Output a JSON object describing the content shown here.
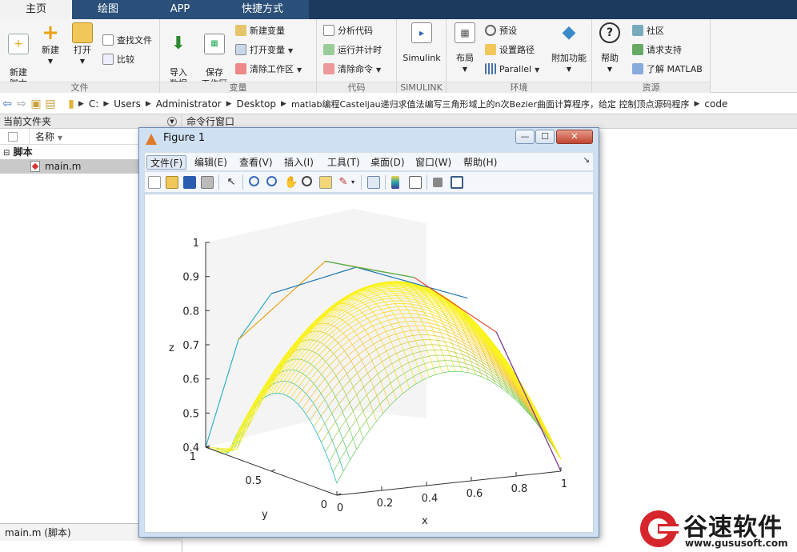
{
  "tabs": [
    "主页",
    "绘图",
    "APP",
    "快捷方式"
  ],
  "ribbon": {
    "file_group": {
      "label": "文件",
      "new_script": "新建\n脚本",
      "new": "新建",
      "open": "打开",
      "find_files": "查找文件",
      "compare": "比较"
    },
    "variable_group": {
      "label": "变量",
      "import": "导入\n数据",
      "save_ws": "保存\n工作区",
      "new_var": "新建变量",
      "open_var": "打开变量",
      "clear_ws": "清除工作区"
    },
    "code_group": {
      "label": "代码",
      "analyze": "分析代码",
      "run_time": "运行并计时",
      "clear_cmd": "清除命令"
    },
    "simulink_group": {
      "label": "SIMULINK",
      "simulink": "Simulink"
    },
    "env_group": {
      "label": "环境",
      "layout": "布局",
      "prefs": "预设",
      "set_path": "设置路径",
      "parallel": "Parallel",
      "addons": "附加功能"
    },
    "resources_group": {
      "label": "资源",
      "help": "帮助",
      "community": "社区",
      "support": "请求支持",
      "learn": "了解 MATLAB"
    }
  },
  "address": {
    "crumbs": [
      "C:",
      "Users",
      "Administrator",
      "Desktop",
      "matlab编程Casteljau递归求值法编写三角形域上的n次Bezier曲面计算程序，给定 控制顶点源码程序",
      "code"
    ]
  },
  "left_panel": {
    "title": "当前文件夹",
    "col_name": "名称",
    "folder": "脚本",
    "file": "main.m",
    "footer": "main.m  (脚本)"
  },
  "cmd_panel": {
    "title": "命令行窗口"
  },
  "figure": {
    "title": "Figure 1",
    "menus": [
      "文件(F)",
      "编辑(E)",
      "查看(V)",
      "插入(I)",
      "工具(T)",
      "桌面(D)",
      "窗口(W)",
      "帮助(H)"
    ],
    "axes": {
      "z_ticks": [
        "0.4",
        "0.5",
        "0.6",
        "0.7",
        "0.8",
        "0.9",
        "1"
      ],
      "x_ticks": [
        "0",
        "0.2",
        "0.4",
        "0.6",
        "0.8",
        "1"
      ],
      "y_ticks": [
        "0",
        "0.5",
        "1"
      ],
      "xlabel": "x",
      "ylabel": "y",
      "zlabel": "z"
    }
  },
  "watermark": {
    "cn": "谷速软件",
    "url": "www.gususoft.com"
  }
}
